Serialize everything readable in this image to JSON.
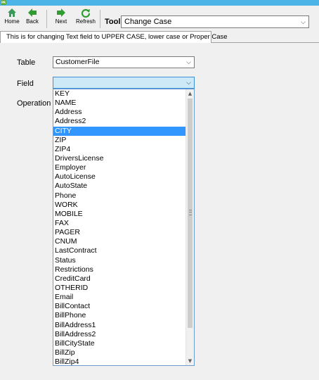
{
  "app": {
    "icon_text": "PR"
  },
  "toolbar": {
    "home_label": "Home",
    "back_label": "Back",
    "next_label": "Next",
    "refresh_label": "Refresh",
    "tool_label": "Tool",
    "tool_value": "Change Case"
  },
  "colors": {
    "titlebar": "#4db4e8",
    "selection": "#3296ff",
    "focus_field": "#cde8f7",
    "home_icon": "#3a9a5a",
    "nav_arrow": "#2e9c2e"
  },
  "icons": {
    "home": "home-icon",
    "back": "back-arrow-icon",
    "next": "next-arrow-icon",
    "refresh": "refresh-icon",
    "dropdown": "chevron-down-icon"
  },
  "tab": {
    "label": "This is for changing Text field to UPPER CASE, lower case or Proper Case"
  },
  "form": {
    "table_label": "Table",
    "table_value": "CustomerFile",
    "field_label": "Field",
    "field_value": "",
    "operation_label": "Operation"
  },
  "field_options": [
    "KEY",
    "NAME",
    "Address",
    "Address2",
    "CITY",
    "ZIP",
    "ZIP4",
    "DriversLicense",
    "Employer",
    "AutoLicense",
    "AutoState",
    "Phone",
    "WORK",
    "MOBILE",
    "FAX",
    "PAGER",
    "CNUM",
    "LastContract",
    "Status",
    "Restrictions",
    "CreditCard",
    "OTHERID",
    "Email",
    "BillContact",
    "BillPhone",
    "BillAddress1",
    "BillAddress2",
    "BillCityState",
    "BillZip",
    "BillZip4"
  ],
  "highlighted_option": "CITY"
}
